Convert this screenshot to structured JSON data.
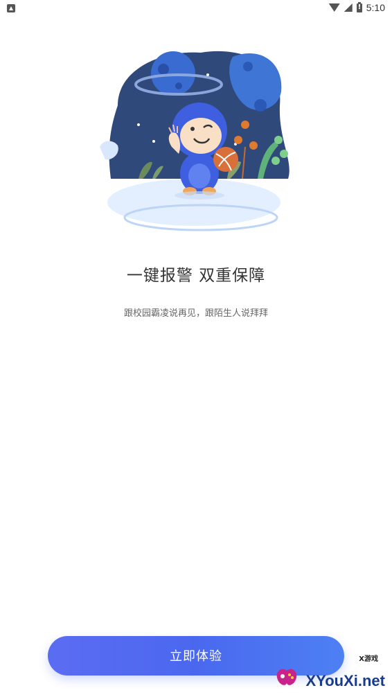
{
  "status_bar": {
    "time": "5:10"
  },
  "onboarding": {
    "headline": "一键报警 双重保障",
    "subline": "跟校园霸凌说再见，跟陌生人说拜拜",
    "cta_label": "立即体验"
  },
  "watermark": {
    "small_text": "X游戏",
    "main_text": "XYouXi.net"
  },
  "colors": {
    "accent": "#5468f0",
    "illustration_night": "#2f4a7a",
    "mascot_blue": "#3e5fe0"
  }
}
